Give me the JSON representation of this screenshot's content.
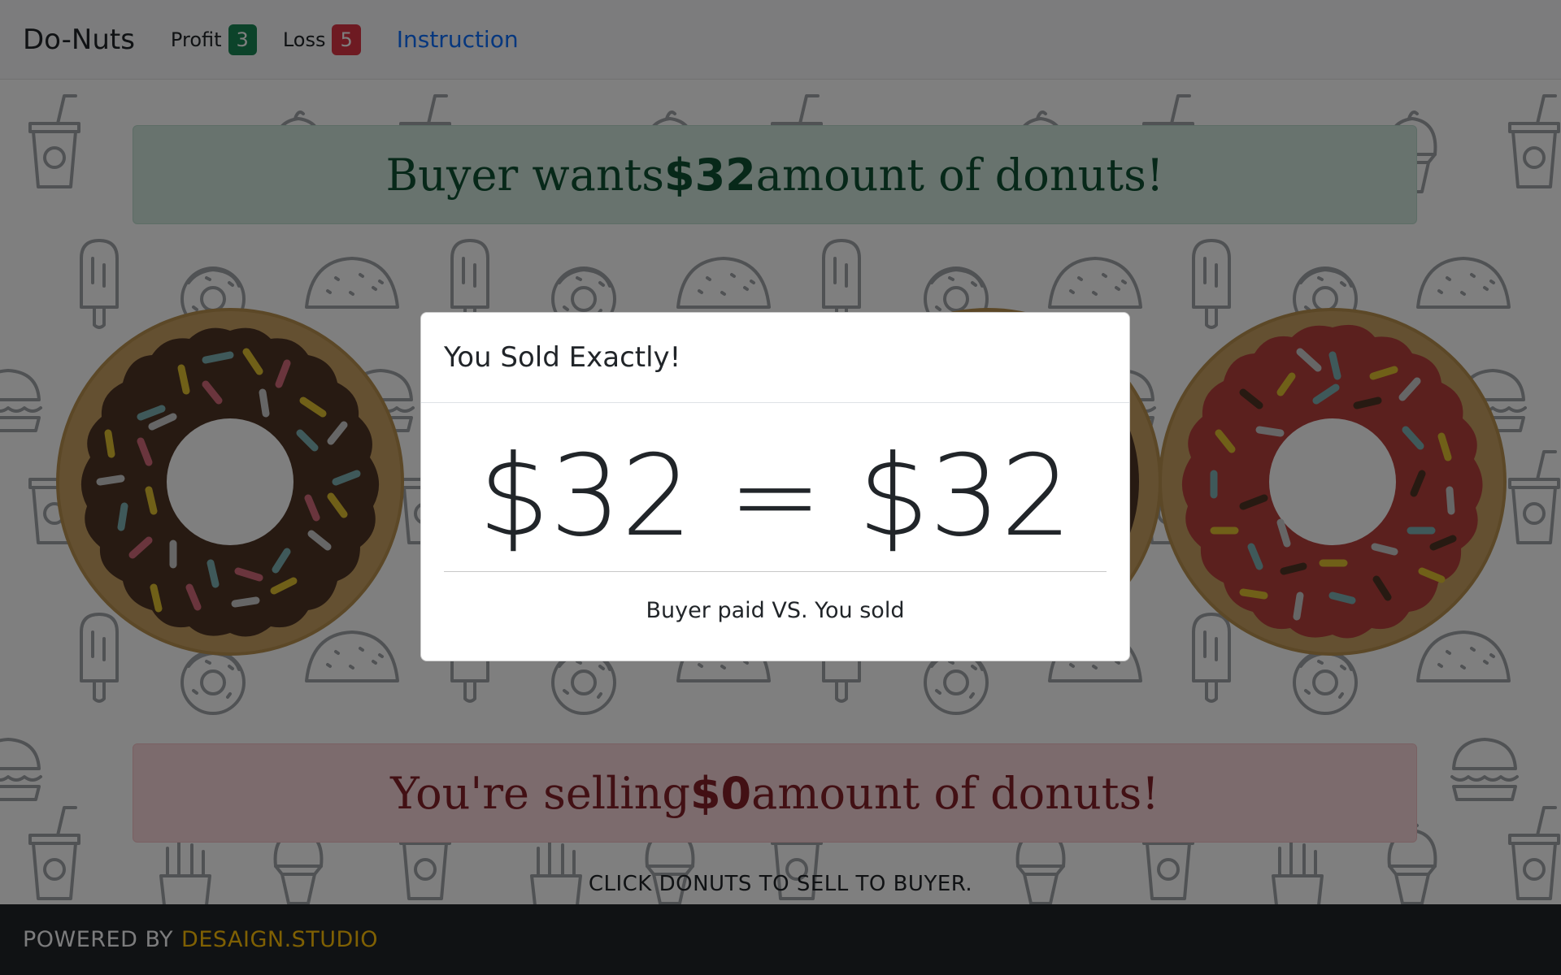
{
  "navbar": {
    "brand": "Do-Nuts",
    "profit_label": "Profit",
    "profit_count": "3",
    "loss_label": "Loss",
    "loss_count": "5",
    "instruction_link": "Instruction"
  },
  "buyer_alert": {
    "prefix": "Buyer wants ",
    "amount": "$32",
    "suffix": " amount of donuts!"
  },
  "seller_alert": {
    "prefix": "You're selling ",
    "amount": "$0",
    "suffix": " amount of donuts!"
  },
  "hint": "CLICK DONUTS TO SELL TO BUYER.",
  "footer": {
    "powered_by": "POWERED BY",
    "studio": "DESAIGN.STUDIO"
  },
  "modal": {
    "title": "You Sold Exactly!",
    "equation": "$32 = $32",
    "caption": "Buyer paid VS. You sold"
  },
  "colors": {
    "profit_badge": "#198754",
    "loss_badge": "#dc3545",
    "link": "#0d6efd",
    "footer_accent": "#ffc107",
    "donut_dough": "#c9a063",
    "chocolate_icing": "#4e3424",
    "strawberry_icing": "#b7403d"
  },
  "icons": [
    "cup-icon",
    "ice-cream-icon",
    "popsicle-icon",
    "taco-icon",
    "donut-icon",
    "burger-icon",
    "fries-icon"
  ]
}
